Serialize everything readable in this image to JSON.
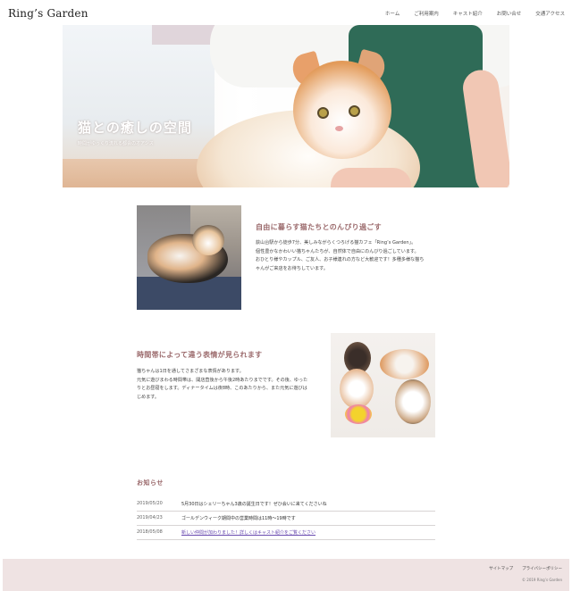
{
  "header": {
    "logo": "Ring’s Garden",
    "nav": [
      "ホーム",
      "ご利用案内",
      "キャスト紹介",
      "お問い合せ",
      "交通アクセス"
    ]
  },
  "hero": {
    "title": "猫との癒しの空間",
    "subtitle": "時間がゆっくり流れる都会のオアシス"
  },
  "section1": {
    "title": "自由に暮らす猫たちとのんびり過ごす",
    "lines": [
      "荻山台駅から徒歩7分、美しみながらくつろげる猫カフェ「Ring’s Garden」。",
      "個性豊かなかわいい猫ちゃんたちが、自然体で自由にのんびり過ごしています。",
      "おひとり様やカップル、ご友人、お子様連れの方など大歓迎です！多種多様な猫ち",
      "ゃんがご来店をお待ちしています。"
    ]
  },
  "section2": {
    "title": "時間帯によって違う表情が見られます",
    "lines": [
      "猫ちゃんは1日を通してさまざまな表情があります。",
      "元気に遊びまわる時間帯は、開店直後から午後2時あたりまでです。その後、ゆった",
      "りとお昼寝をします。ディナータイムは夜8時、このあたりから、また元気に遊びは",
      "じめます。"
    ]
  },
  "news": {
    "title": "お知らせ",
    "items": [
      {
        "date": "2019/05/20",
        "text": "5月30日はシェリーちゃん3歳の誕生日です！ぜひ会いに来てくださいね",
        "link": false
      },
      {
        "date": "2019/04/23",
        "text": "ゴールデンウィーク期間中の営業時間は11時〜19時です",
        "link": false
      },
      {
        "date": "2018/05/08",
        "text": "新しい仲間が加わりました！詳しくはキャスト紹介をご覧ください",
        "link": true
      }
    ]
  },
  "footer": {
    "links": [
      "サイトマップ",
      "プライバシーポリシー"
    ],
    "copyright": "© 2019 Ring’s Garden"
  },
  "colors": {
    "accent": "#9b6a6c",
    "footer_bg": "#efe3e3",
    "link": "#6a4bb0"
  }
}
